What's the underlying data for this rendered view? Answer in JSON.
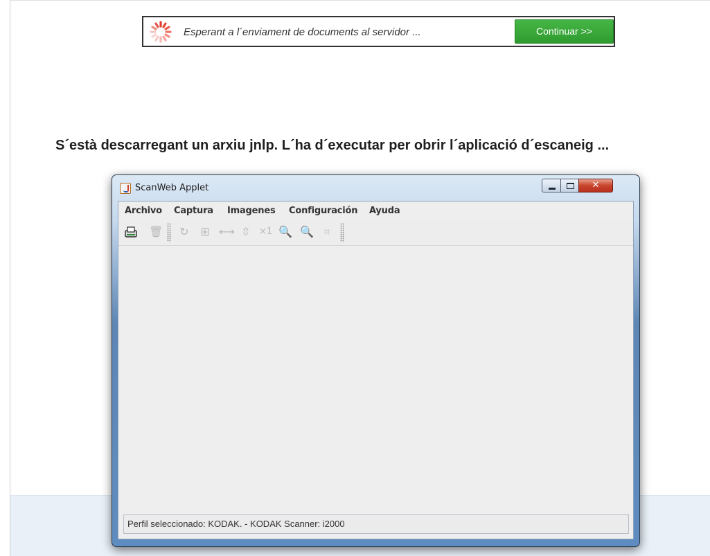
{
  "banner": {
    "waiting_text": "Esperant a l´enviament de documents al servidor ...",
    "continue_label": "Continuar >>"
  },
  "headline": "S´està descarregant un arxiu jnlp. L´ha d´executar per obrir l´aplicació d´escaneig ...",
  "applet": {
    "title": "ScanWeb Applet",
    "menu": [
      "Archivo",
      "Captura",
      "Imagenes",
      "Configuración",
      "Ayuda"
    ],
    "toolbar_icons": [
      "scanner-icon",
      "trash-icon",
      "rotate-icon",
      "fit-page-icon",
      "fit-width-icon",
      "fit-height-icon",
      "actual-size-icon",
      "zoom-in-icon",
      "zoom-out-icon",
      "crop-icon"
    ],
    "toolbar_glyph_x1": "×1",
    "status": "Perfil seleccionado: KODAK. - KODAK Scanner: i2000"
  },
  "colors": {
    "continue_button": "#3aa93a",
    "window_frame": "#5f8cc0",
    "close_button": "#c8452c"
  }
}
